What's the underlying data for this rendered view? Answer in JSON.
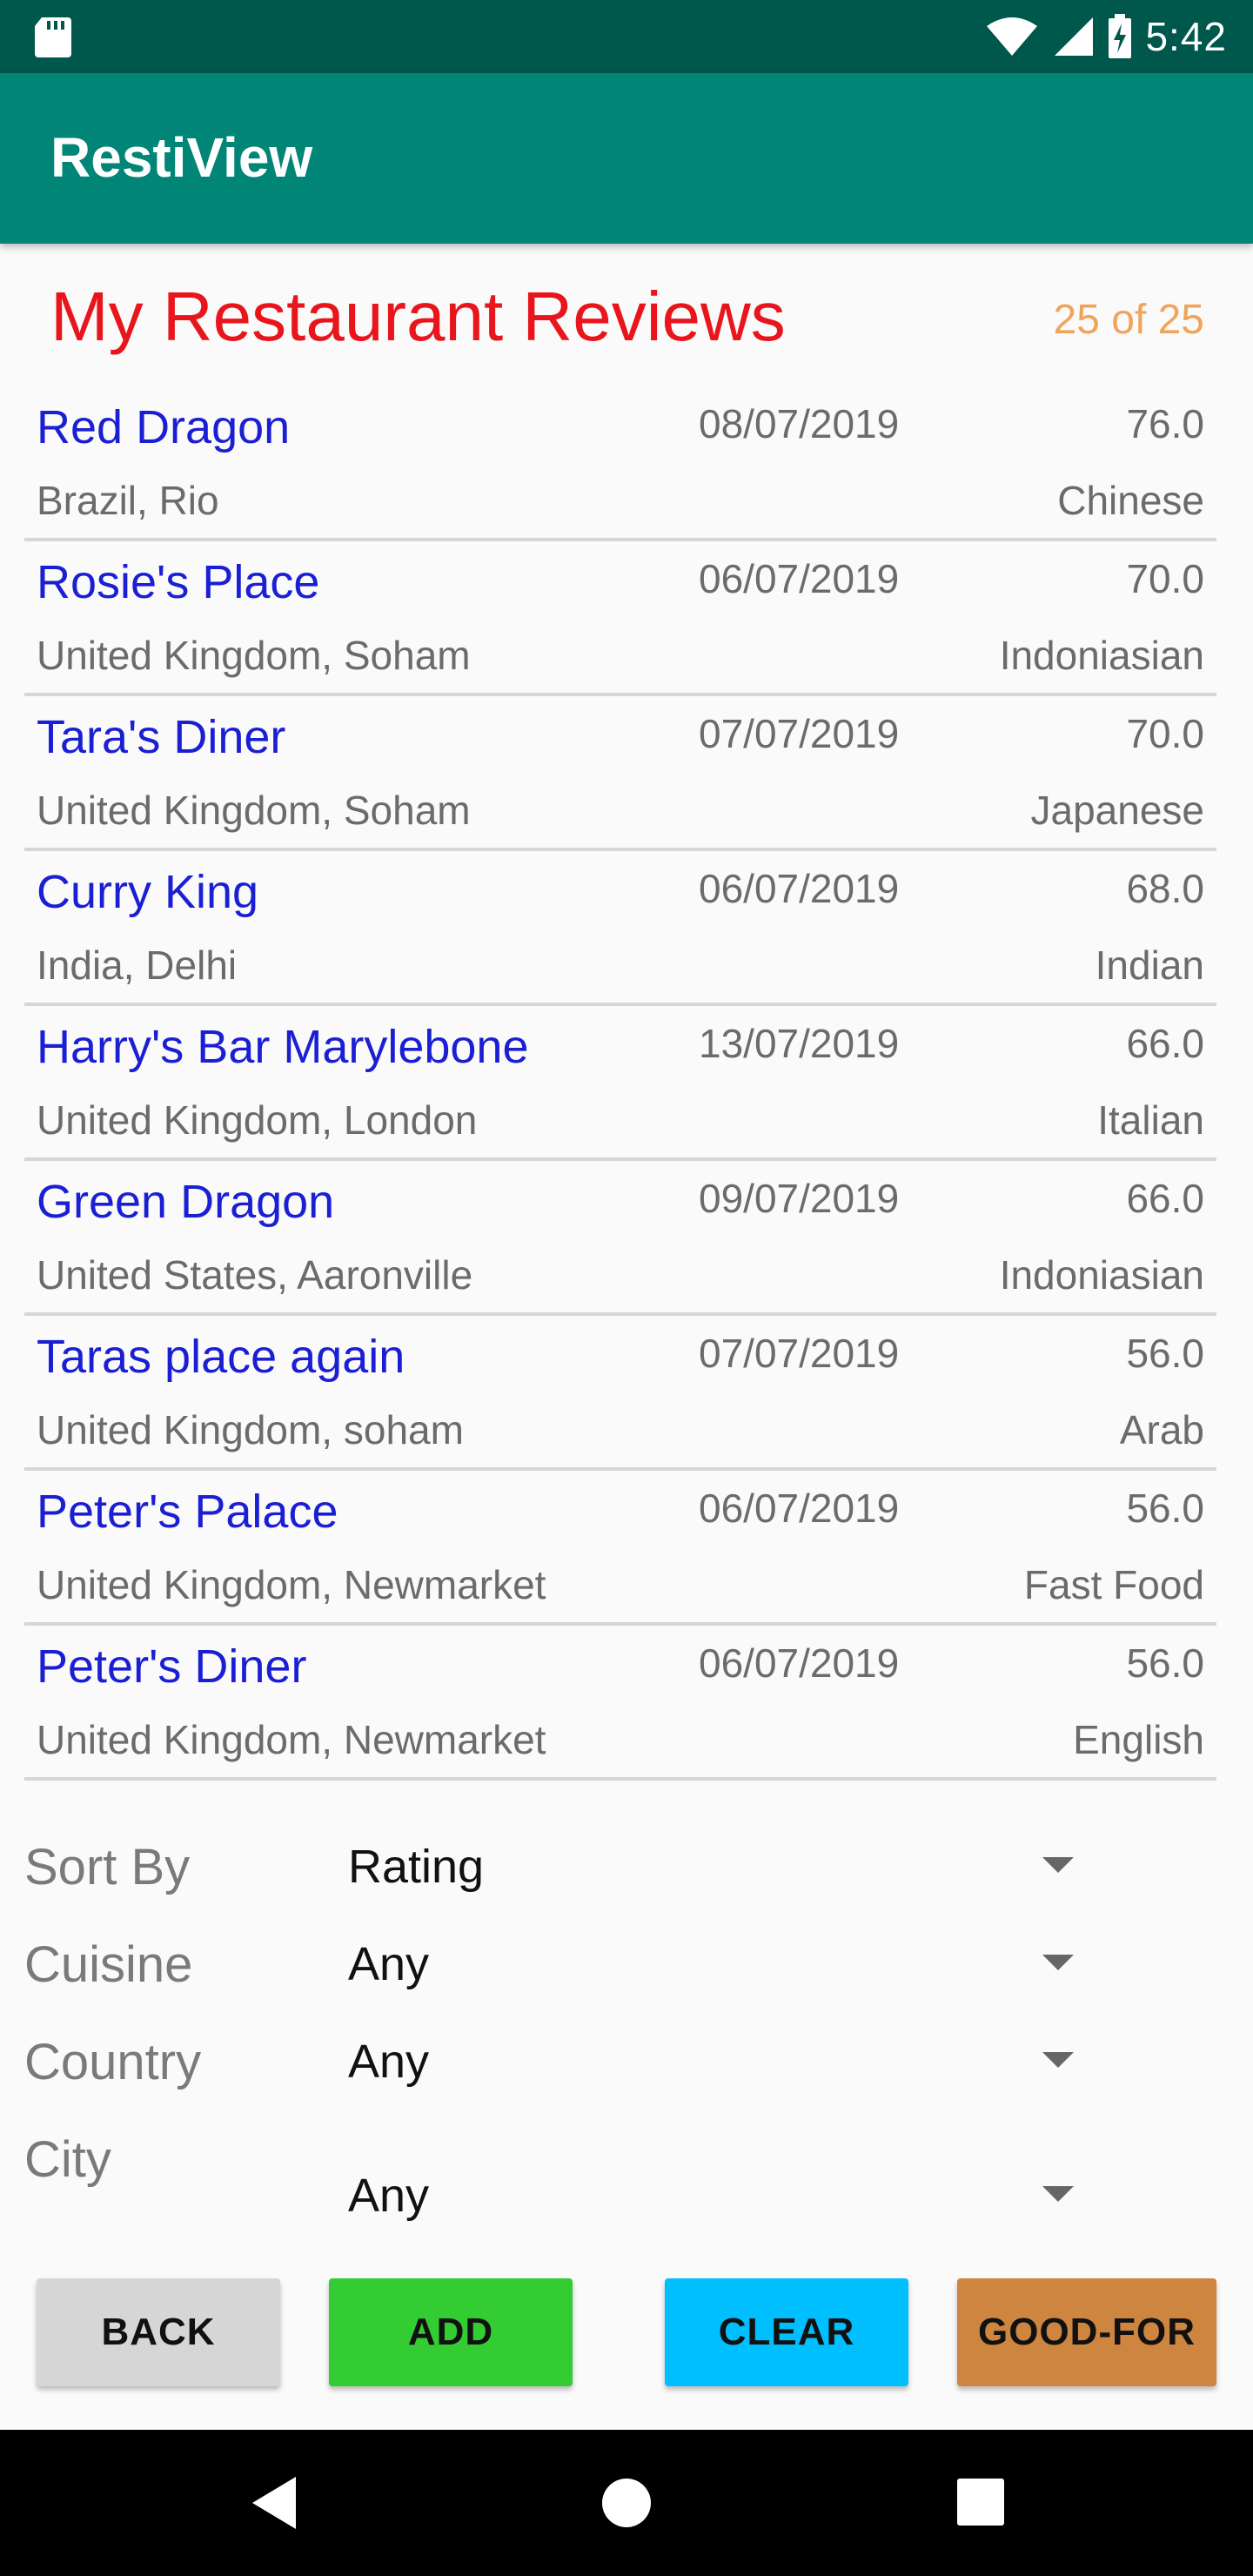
{
  "status_bar": {
    "time": "5:42"
  },
  "app_bar": {
    "title": "RestiView"
  },
  "header": {
    "title": "My Restaurant Reviews",
    "count": "25 of 25"
  },
  "reviews": [
    {
      "name": "Red Dragon",
      "date": "08/07/2019",
      "score": "76.0",
      "location": "Brazil, Rio",
      "cuisine": "Chinese"
    },
    {
      "name": "Rosie's Place",
      "date": "06/07/2019",
      "score": "70.0",
      "location": "United Kingdom, Soham",
      "cuisine": "Indoniasian"
    },
    {
      "name": "Tara's Diner",
      "date": "07/07/2019",
      "score": "70.0",
      "location": "United Kingdom, Soham",
      "cuisine": "Japanese"
    },
    {
      "name": "Curry King",
      "date": "06/07/2019",
      "score": "68.0",
      "location": "India, Delhi",
      "cuisine": "Indian"
    },
    {
      "name": "Harry's Bar Marylebone",
      "date": "13/07/2019",
      "score": "66.0",
      "location": "United Kingdom, London",
      "cuisine": "Italian"
    },
    {
      "name": "Green Dragon",
      "date": "09/07/2019",
      "score": "66.0",
      "location": "United States, Aaronville",
      "cuisine": "Indoniasian"
    },
    {
      "name": "Taras place again",
      "date": "07/07/2019",
      "score": "56.0",
      "location": "United Kingdom, soham",
      "cuisine": "Arab"
    },
    {
      "name": "Peter's Palace",
      "date": "06/07/2019",
      "score": "56.0",
      "location": "United Kingdom, Newmarket",
      "cuisine": "Fast Food"
    },
    {
      "name": "Peter's Diner",
      "date": "06/07/2019",
      "score": "56.0",
      "location": "United Kingdom, Newmarket",
      "cuisine": "English"
    }
  ],
  "filters": {
    "sort_by": {
      "label": "Sort By",
      "value": "Rating"
    },
    "cuisine": {
      "label": "Cuisine",
      "value": "Any"
    },
    "country": {
      "label": "Country",
      "value": "Any"
    },
    "city": {
      "label": "City",
      "value": "Any"
    }
  },
  "buttons": {
    "back": {
      "label": "BACK",
      "color": "#d6d6d6"
    },
    "add": {
      "label": "ADD",
      "color": "#33cc33"
    },
    "clear": {
      "label": "CLEAR",
      "color": "#00bfff"
    },
    "good_for": {
      "label": "GOOD-FOR",
      "color": "#cd853f"
    }
  },
  "colors": {
    "status_bar": "#00574b",
    "app_bar": "#008577",
    "title": "#e8161c",
    "count": "#f0a45b",
    "restaurant_name": "#1b1fd3"
  }
}
